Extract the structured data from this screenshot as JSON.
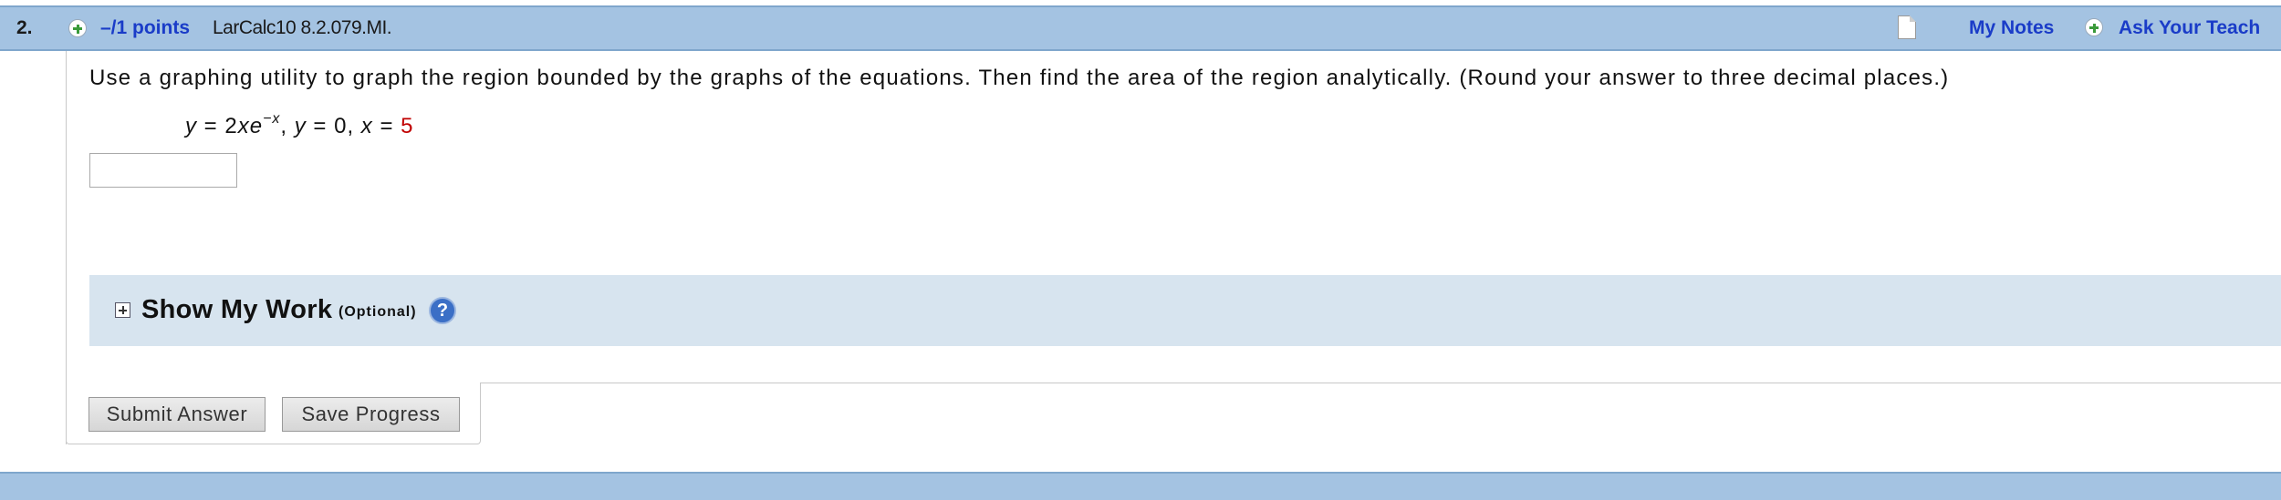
{
  "question": {
    "number": "2.",
    "points": "–/1 points",
    "source": "LarCalc10 8.2.079.MI.",
    "my_notes": "My Notes",
    "ask_teacher": "Ask Your Teach"
  },
  "problem": {
    "prompt": "Use a graphing utility to graph the region bounded by the graphs of the equations. Then find the area of the region analytically. (Round your answer to three decimal places.)",
    "equation": {
      "y1_var": "y",
      "y1_rhs": " = 2",
      "x_var": "x",
      "e_var": "e",
      "exponent": "−x",
      "sep1": ", ",
      "y2_var": "y",
      "y2_rhs": " = 0, ",
      "x2_var": "x",
      "x2_eq": " = ",
      "x2_value": "5"
    },
    "answer_value": ""
  },
  "show_my_work": {
    "title": "Show My Work",
    "optional": "(Optional)",
    "help": "?"
  },
  "buttons": {
    "submit": "Submit Answer",
    "save": "Save Progress"
  },
  "colors": {
    "header_bg": "#a4c3e2",
    "link": "#1a3cc8",
    "highlight_value": "#c00000",
    "show_my_work_bg": "#d7e4ef"
  },
  "icons": {
    "points_expand": "plus-circle-icon",
    "notes": "note-icon",
    "ask_teacher": "plus-circle-icon",
    "show_my_work_expand": "plus-box-icon",
    "help": "question-circle-icon"
  }
}
